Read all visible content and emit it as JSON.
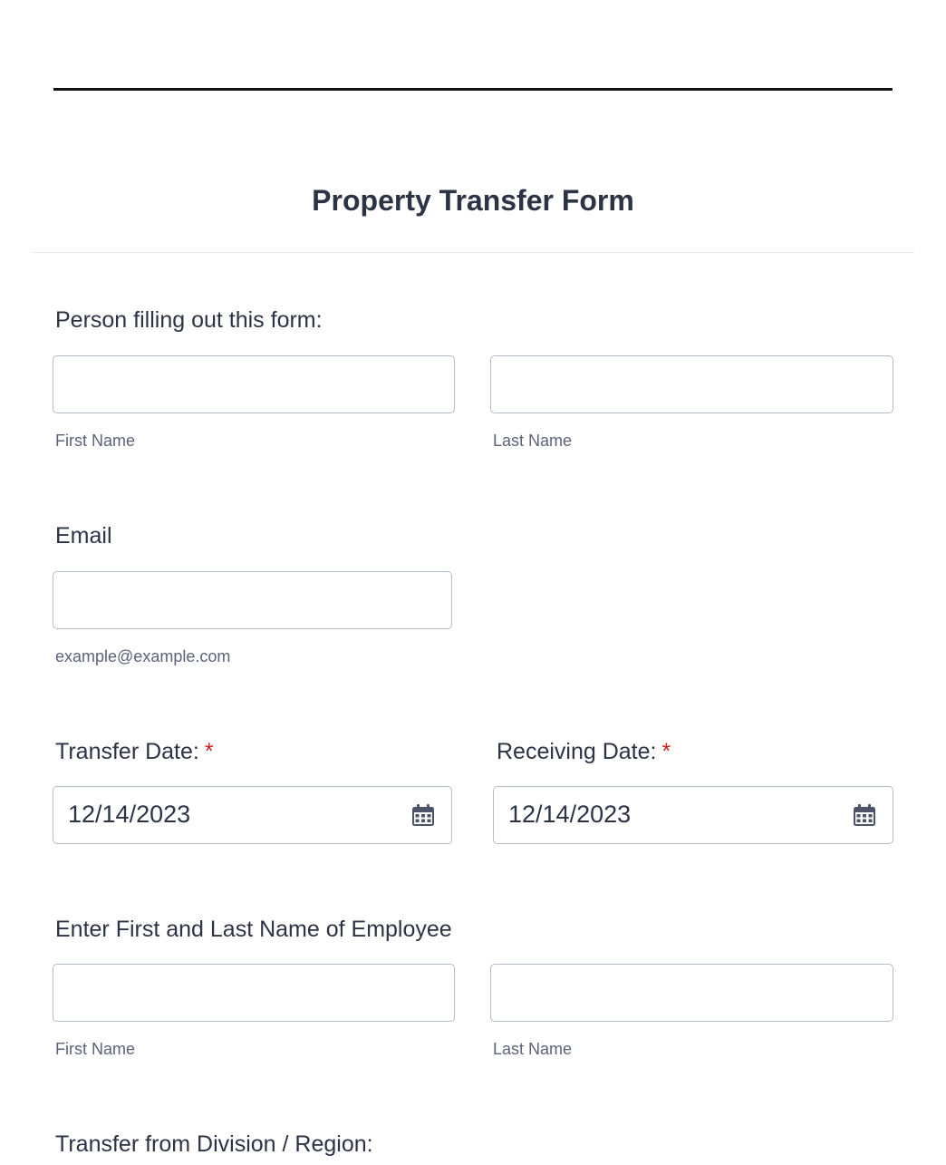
{
  "form": {
    "title": "Property Transfer Form"
  },
  "person_filling": {
    "label": "Person filling out this form:",
    "first_name": {
      "value": "",
      "sublabel": "First Name"
    },
    "last_name": {
      "value": "",
      "sublabel": "Last Name"
    }
  },
  "email": {
    "label": "Email",
    "value": "",
    "sublabel": "example@example.com"
  },
  "transfer_date": {
    "label": "Transfer Date:",
    "required_mark": "*",
    "value": "12/14/2023",
    "icon": "calendar-icon"
  },
  "receiving_date": {
    "label": "Receiving Date:",
    "required_mark": "*",
    "value": "12/14/2023",
    "icon": "calendar-icon"
  },
  "employee_name": {
    "label": "Enter First and Last Name of Employee",
    "first_name": {
      "value": "",
      "sublabel": "First Name"
    },
    "last_name": {
      "value": "",
      "sublabel": "Last Name"
    }
  },
  "transfer_from": {
    "label": "Transfer from Division / Region:"
  },
  "colors": {
    "text": "#2c3345",
    "sublabel": "#5c6378",
    "required": "#d21d1d",
    "input_border": "#b6bbcb",
    "icon": "#4d5468"
  }
}
